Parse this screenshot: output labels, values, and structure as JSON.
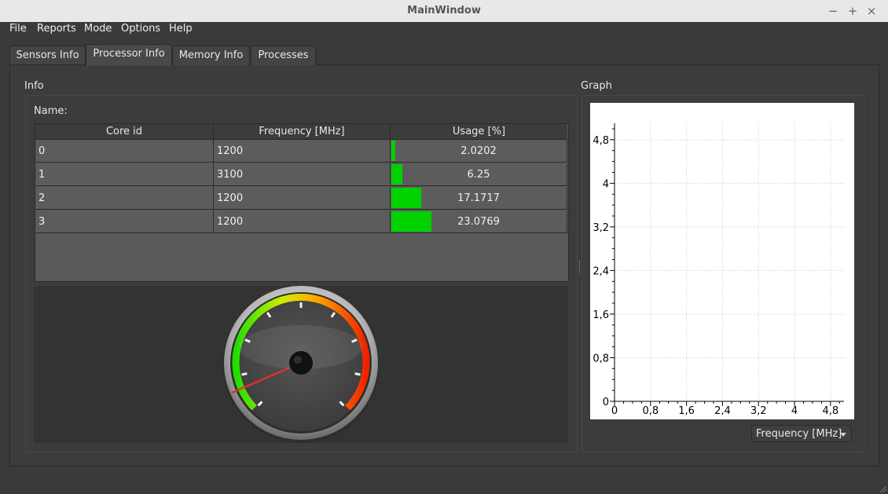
{
  "window": {
    "title": "MainWindow",
    "minimize": "−",
    "maximize": "+",
    "close": "×"
  },
  "menu": [
    "File",
    "Reports",
    "Mode",
    "Options",
    "Help"
  ],
  "tabs": [
    "Sensors Info",
    "Processor Info",
    "Memory Info",
    "Processes"
  ],
  "active_tab": 1,
  "info": {
    "title": "Info",
    "name_label": "Name:",
    "columns": [
      "Core id",
      "Frequency [MHz]",
      "Usage [%]"
    ],
    "rows": [
      {
        "core": "0",
        "freq": "1200",
        "usage": "2.0202",
        "usage_pct": 2.0202
      },
      {
        "core": "1",
        "freq": "3100",
        "usage": "6.25",
        "usage_pct": 6.25
      },
      {
        "core": "2",
        "freq": "1200",
        "usage": "17.1717",
        "usage_pct": 17.1717
      },
      {
        "core": "3",
        "freq": "1200",
        "usage": "23.0769",
        "usage_pct": 23.0769
      }
    ],
    "gauge": {
      "needle_fraction": 0.08
    }
  },
  "graph": {
    "title": "Graph",
    "x_ticks": [
      "0",
      "0,8",
      "1,6",
      "2,4",
      "3,2",
      "4",
      "4,8"
    ],
    "y_ticks": [
      "0",
      "0,8",
      "1,6",
      "2,4",
      "3,2",
      "4",
      "4,8"
    ],
    "combo_value": "Frequency [MHz]"
  },
  "colors": {
    "usage_bar": "#00d100",
    "background": "#3a3a3a"
  }
}
